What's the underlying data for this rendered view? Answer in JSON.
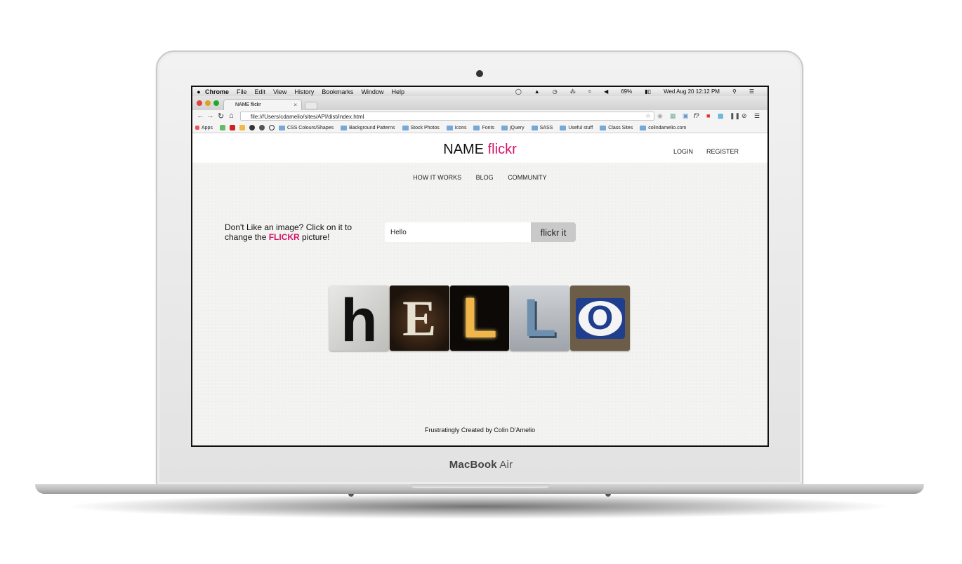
{
  "device": {
    "brand_main": "MacBook",
    "brand_sub": "Air"
  },
  "mac_menubar": {
    "items": [
      "Chrome",
      "File",
      "Edit",
      "View",
      "History",
      "Bookmarks",
      "Window",
      "Help"
    ],
    "battery": "69%",
    "datetime": "Wed Aug 20  12:12 PM"
  },
  "browser": {
    "tab_title": "NAME flickr",
    "url": "file:///Users/cdamelio/sites/API/dist/index.html",
    "bookmarks": [
      "Apps",
      "CSS Colours/Shapes",
      "Background Patterns",
      "Stock Photos",
      "Icons",
      "Fonts",
      "jQuery",
      "SASS",
      "Useful stuff",
      "Class Sites",
      "colindamelio.com"
    ]
  },
  "site": {
    "logo_main": "NAME",
    "logo_accent": "flickr",
    "login": "LOGIN",
    "register": "REGISTER",
    "nav": [
      "HOW IT WORKS",
      "BLOG",
      "COMMUNITY"
    ],
    "prompt_line1": "Don't Like an image? Click on it to",
    "prompt_line2a": "change the ",
    "prompt_highlight": "FLICKR",
    "prompt_line2b": " picture!",
    "search_value": "Hello",
    "search_button": "flickr it",
    "tiles": [
      "h",
      "E",
      "L",
      "L",
      "O"
    ],
    "footer": "Frustratingly Created by Colin D'Amelio"
  },
  "colors": {
    "accent": "#d4146a"
  }
}
